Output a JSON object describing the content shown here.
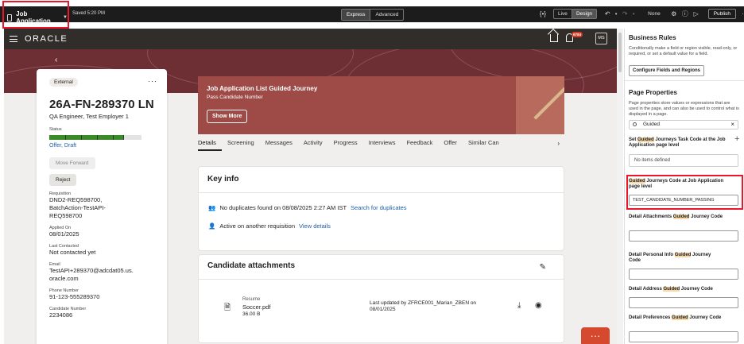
{
  "toolbar": {
    "app_title": "Job Application",
    "saved": "Saved 5:20 PM",
    "mode_express": "Express",
    "mode_advanced": "Advanced",
    "bracket_icon": "{•}",
    "live": "Live",
    "design": "Design",
    "filter_none": "None",
    "publish": "Publish"
  },
  "header": {
    "logo": "ORACLE",
    "notification_count": "6784",
    "avatar_initials": "MS"
  },
  "candidate": {
    "badge": "External",
    "id": "26A-FN-289370 LN",
    "subtitle": "QA Engineer, Test Employer 1",
    "status_label": "Status",
    "status_value": "Offer, Draft",
    "move_forward": "Move Forward",
    "reject": "Reject",
    "requisition_label": "Requisition",
    "requisition_value_1": "DND2-REQ598700,",
    "requisition_value_2": "BatchAction-TestAPI-",
    "requisition_value_3": "REQ598700",
    "applied_label": "Applied On",
    "applied_value": "08/01/2025",
    "contacted_label": "Last Contacted",
    "contacted_value": "Not contacted yet",
    "email_label": "Email",
    "email_value_1": "TestAPI+289370@adcdat05.us.",
    "email_value_2": "oracle.com",
    "phone_label": "Phone Number",
    "phone_value": "91-123-555289370",
    "number_label": "Candidate Number",
    "number_value": "2234086"
  },
  "journey": {
    "title": "Job Application List Guided Journey",
    "subtitle": "Pass Candidate Number",
    "show_more": "Show More"
  },
  "tabs": [
    "Details",
    "Screening",
    "Messages",
    "Activity",
    "Progress",
    "Interviews",
    "Feedback",
    "Offer",
    "Similar Can"
  ],
  "key_info": {
    "title": "Key info",
    "duplicates_text": "No duplicates found on 08/08/2025 2:27 AM IST",
    "duplicates_link": "Search for duplicates",
    "active_text": "Active on another requisition",
    "active_link": "View details"
  },
  "attachments": {
    "title": "Candidate attachments",
    "type": "Resume",
    "file": "Soccer.pdf",
    "size": "36.00 B",
    "updated_1": "Last updated by ZFRCE001_Marian_ZBEN on",
    "updated_2": "08/01/2025"
  },
  "right_panel": {
    "business_rules_title": "Business Rules",
    "business_rules_desc": "Conditionally make a field or region visible, read-only, or required, or set a default value for a field.",
    "configure_button": "Configure Fields and Regions",
    "page_props_title": "Page Properties",
    "page_props_desc": "Page properties store values or expressions that are used in the page, and can also be used to control what is displayed in a page.",
    "search_value": "Guided",
    "task_code_label_pre": "Set ",
    "task_code_label_hl": "Guided",
    "task_code_label_post": " Journeys Task Code at the Job Application page level",
    "no_items": "No items defined",
    "journey_code_label_hl": "Guided",
    "journey_code_label_post": " Journeys Code at Job Application page level",
    "journey_code_value": "TEST_CANDIDATE_NUMBER_PASSING",
    "attach_label_pre": "Detail Attachments ",
    "attach_label_hl": "Guided",
    "attach_label_post": " Journey Code",
    "personal_label_pre": "Detail Personal Info ",
    "personal_label_hl": "Guided",
    "personal_label_post": " Journey Code",
    "address_label_pre": "Detail Address ",
    "address_label_hl": "Guided",
    "address_label_post": " Journey Code",
    "prefs_label_pre": "Detail Preferences ",
    "prefs_label_hl": "Guided",
    "prefs_label_post": " Journey Code"
  },
  "colors": {
    "header_bg": "#312d2a",
    "banner": "#6e2f34",
    "journey_bg": "#9e4a47",
    "link": "#1f5fa9",
    "highlight_box": "#e8172a",
    "search_highlight": "#f7d9a9"
  }
}
